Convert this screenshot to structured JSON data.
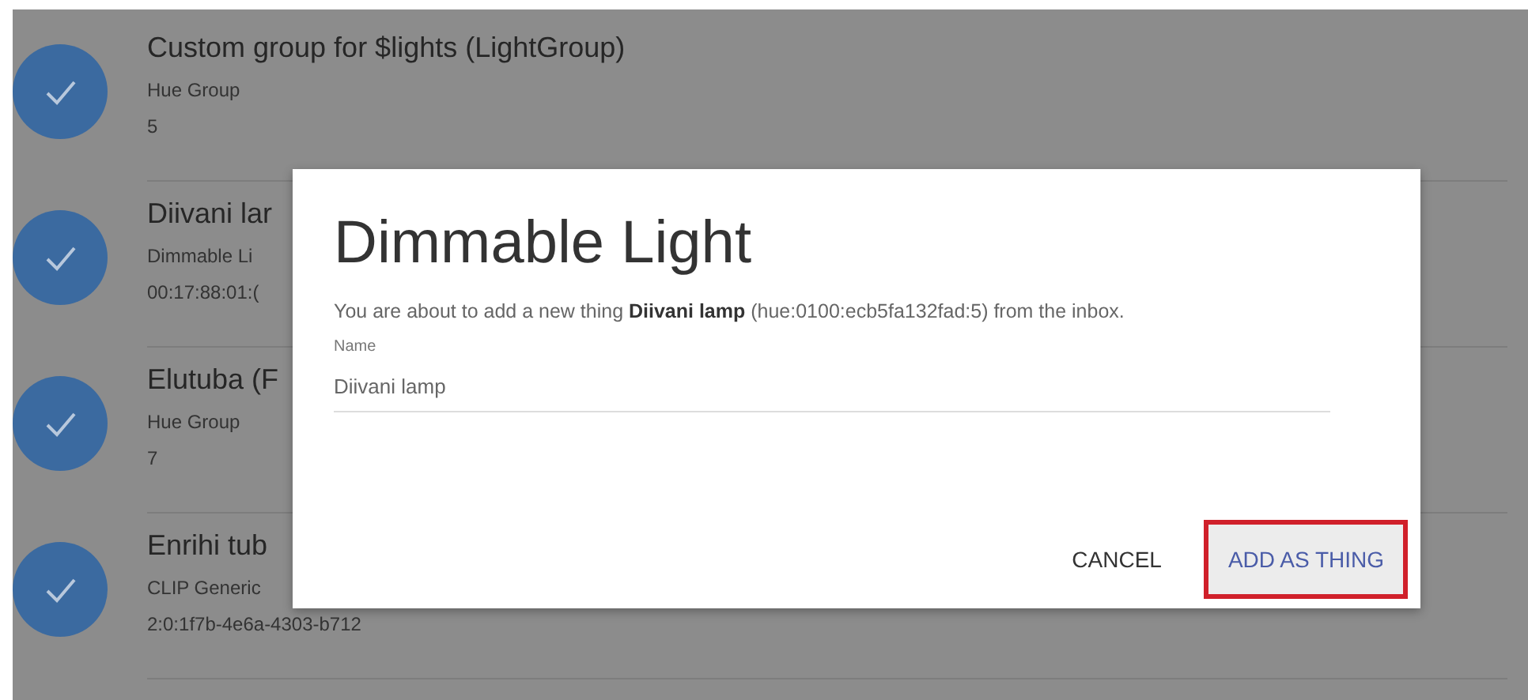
{
  "list": [
    {
      "title": "Custom group for $lights (LightGroup)",
      "lines": [
        "Hue Group",
        "5"
      ]
    },
    {
      "title": "Diivani lar",
      "lines": [
        "Dimmable Li",
        "00:17:88:01:("
      ]
    },
    {
      "title": "Elutuba (F",
      "lines": [
        "Hue Group",
        "7"
      ]
    },
    {
      "title": "Enrihi tub",
      "lines": [
        "CLIP Generic",
        "2:0:1f7b-4e6a-4303-b712"
      ]
    }
  ],
  "dialog": {
    "title": "Dimmable Light",
    "message": "You are about to add a new thing **Diivani lamp** (hue:0100:ecb5fa132fad:5) from the inbox.",
    "field": {
      "label": "Name",
      "value": "Diivani lamp"
    },
    "buttons": [
      {
        "label": "CANCEL",
        "kind": "plain",
        "highlighted": false
      },
      {
        "label": "ADD AS THING",
        "kind": "primary",
        "highlighted": true
      }
    ]
  }
}
